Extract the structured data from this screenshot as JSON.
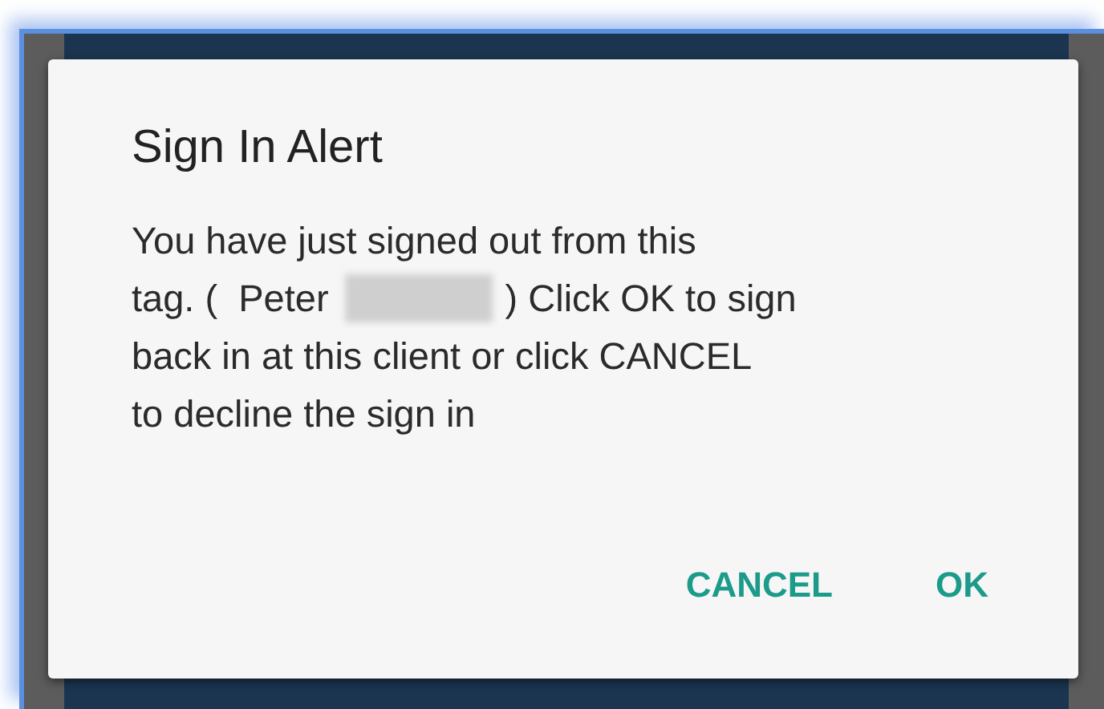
{
  "dialog": {
    "title": "Sign In Alert",
    "message_lines": [
      {
        "parts": [
          {
            "kind": "text",
            "text": "You have just signed out from this"
          }
        ]
      },
      {
        "parts": [
          {
            "kind": "text",
            "text": "tag. (  Peter"
          },
          {
            "kind": "redacted"
          },
          {
            "kind": "text",
            "text": ") Click OK to sign"
          }
        ]
      },
      {
        "parts": [
          {
            "kind": "text",
            "text": "back in at this client or click CANCEL"
          }
        ]
      },
      {
        "parts": [
          {
            "kind": "text",
            "text": "to decline the sign in"
          }
        ]
      }
    ],
    "buttons": [
      {
        "label": "CANCEL"
      },
      {
        "label": "OK"
      }
    ]
  }
}
